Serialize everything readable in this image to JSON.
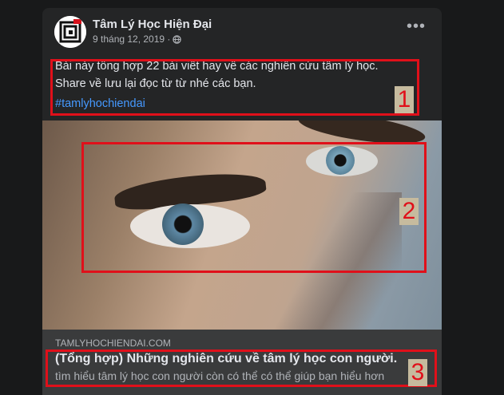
{
  "post": {
    "page_name": "Tâm Lý Học Hiện Đại",
    "date": "9 tháng 12, 2019 ·",
    "more_label": "•••",
    "line1": "Bài này tổng hợp 22 bài viết hay về các nghiên cứu tâm lý học.",
    "line2": "Share về lưu lại đọc từ từ nhé các bạn.",
    "hashtag": "#tamlyhochiendai"
  },
  "link": {
    "domain": "TAMLYHOCHIENDAI.COM",
    "title": "(Tổng hợp) Những nghiên cứu về tâm lý học con người.",
    "description": "tìm hiểu tâm lý học con người còn có thể có thể giúp bạn hiểu hơn"
  },
  "annotations": {
    "label1": "1",
    "label2": "2",
    "label3": "3",
    "color": "#e0101a"
  },
  "icons": {
    "globe": "globe-icon",
    "more": "more-options-icon"
  }
}
